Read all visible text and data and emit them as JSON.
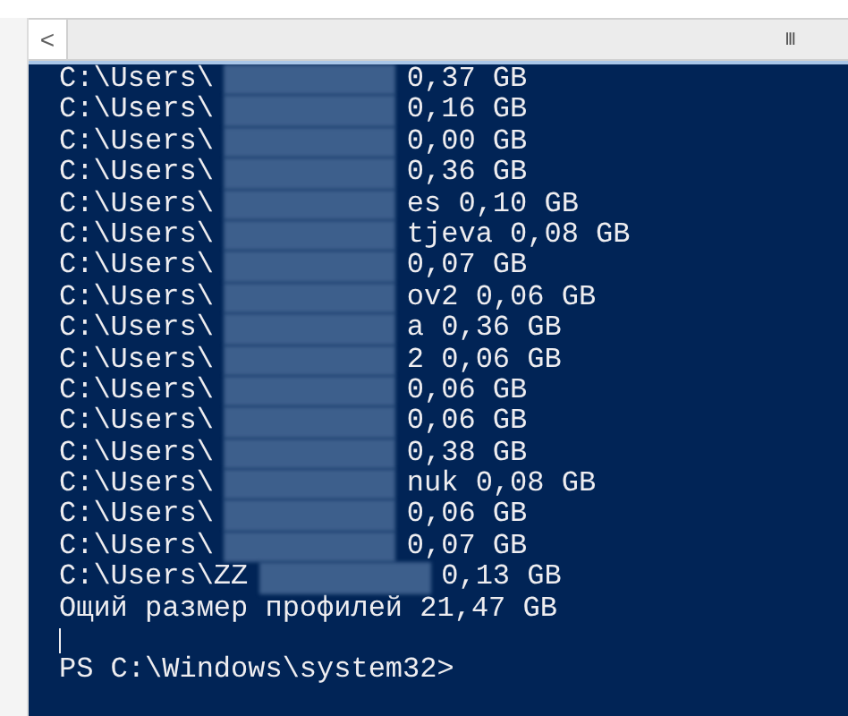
{
  "scrollbar": {
    "left_arrow": "<",
    "grip": "III"
  },
  "lines": [
    {
      "prefix": "C:\\Users\\",
      "suffix": "0,37 GB",
      "redacted": true
    },
    {
      "prefix": "C:\\Users\\",
      "suffix": "0,16 GB",
      "redacted": true
    },
    {
      "prefix": "C:\\Users\\",
      "suffix": "0,00 GB",
      "redacted": true
    },
    {
      "prefix": "C:\\Users\\",
      "suffix": "0,36 GB",
      "redacted": true
    },
    {
      "prefix": "C:\\Users\\",
      "suffix": "es 0,10 GB",
      "redacted": true
    },
    {
      "prefix": "C:\\Users\\",
      "suffix": "tjeva 0,08 GB",
      "redacted": true
    },
    {
      "prefix": "C:\\Users\\",
      "suffix": "0,07 GB",
      "redacted": true
    },
    {
      "prefix": "C:\\Users\\",
      "suffix": "ov2 0,06 GB",
      "redacted": true
    },
    {
      "prefix": "C:\\Users\\",
      "suffix": "a 0,36 GB",
      "redacted": true
    },
    {
      "prefix": "C:\\Users\\",
      "suffix": "2 0,06 GB",
      "redacted": true
    },
    {
      "prefix": "C:\\Users\\",
      "suffix": "0,06 GB",
      "redacted": true
    },
    {
      "prefix": "C:\\Users\\",
      "suffix": "0,06 GB",
      "redacted": true
    },
    {
      "prefix": "C:\\Users\\",
      "suffix": "0,38 GB",
      "redacted": true
    },
    {
      "prefix": "C:\\Users\\",
      "suffix": "nuk 0,08 GB",
      "redacted": true
    },
    {
      "prefix": "C:\\Users\\",
      "suffix": "0,06 GB",
      "redacted": true
    },
    {
      "prefix": "C:\\Users\\",
      "suffix": "0,07 GB",
      "redacted": true
    },
    {
      "prefix": "C:\\Users\\ZZ",
      "suffix": "0,13 GB",
      "redacted": true
    },
    {
      "prefix": "Ощий размер профилей 21,47 GB",
      "redacted": false
    }
  ],
  "prompt": "PS C:\\Windows\\system32>"
}
